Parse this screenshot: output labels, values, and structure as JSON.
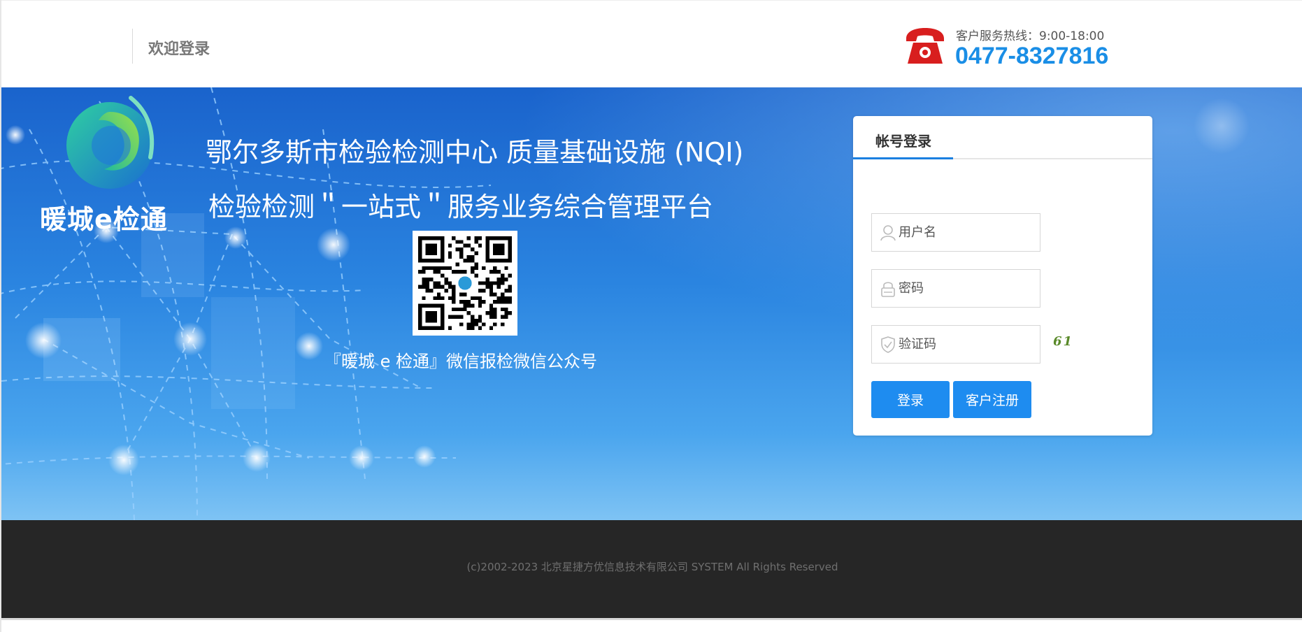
{
  "header": {
    "welcome": "欢迎登录",
    "hotline_label": "客户服务热线：9:00-18:00",
    "hotline_number": "0477-8327816"
  },
  "banner": {
    "logo_name": "暖城e检通",
    "title_line1": "鄂尔多斯市检验检测中心 质量基础设施 (NQI)",
    "title_line2": "检验检测＂一站式＂服务业务综合管理平台",
    "qr_caption": "『暖城 e 检通』微信报检微信公众号"
  },
  "login": {
    "tab_label": "帐号登录",
    "username_placeholder": "用户名",
    "password_placeholder": "密码",
    "captcha_placeholder": "验证码",
    "captcha_value": "61",
    "login_button": "登录",
    "register_button": "客户注册"
  },
  "footer": {
    "copyright": "(c)2002-2023 北京星捷方优信息技术有限公司 SYSTEM All Rights Reserved"
  },
  "colors": {
    "accent": "#1e8cf0",
    "hotline": "#1a8ee6",
    "footer_bg": "#262626",
    "phone_icon": "#d81e1e"
  }
}
